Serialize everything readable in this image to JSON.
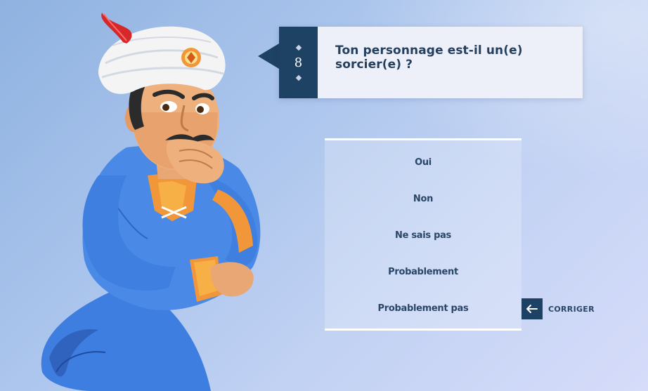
{
  "question": {
    "number": "8",
    "text": "Ton personnage est-il un(e) sorcier(e) ?"
  },
  "answers": [
    {
      "label": "Oui"
    },
    {
      "label": "Non"
    },
    {
      "label": "Ne sais pas"
    },
    {
      "label": "Probablement"
    },
    {
      "label": "Probablement pas"
    }
  ],
  "corriger": {
    "label": "CORRIGER",
    "icon": "arrow-left-icon"
  },
  "colors": {
    "panel_dark": "#1e4263",
    "question_bg": "#edf0f8",
    "text_dark": "#24405e",
    "genie_skin_blue": "#3f7fe0",
    "turban_white": "#f4f4f4",
    "feather_red": "#d62828"
  }
}
